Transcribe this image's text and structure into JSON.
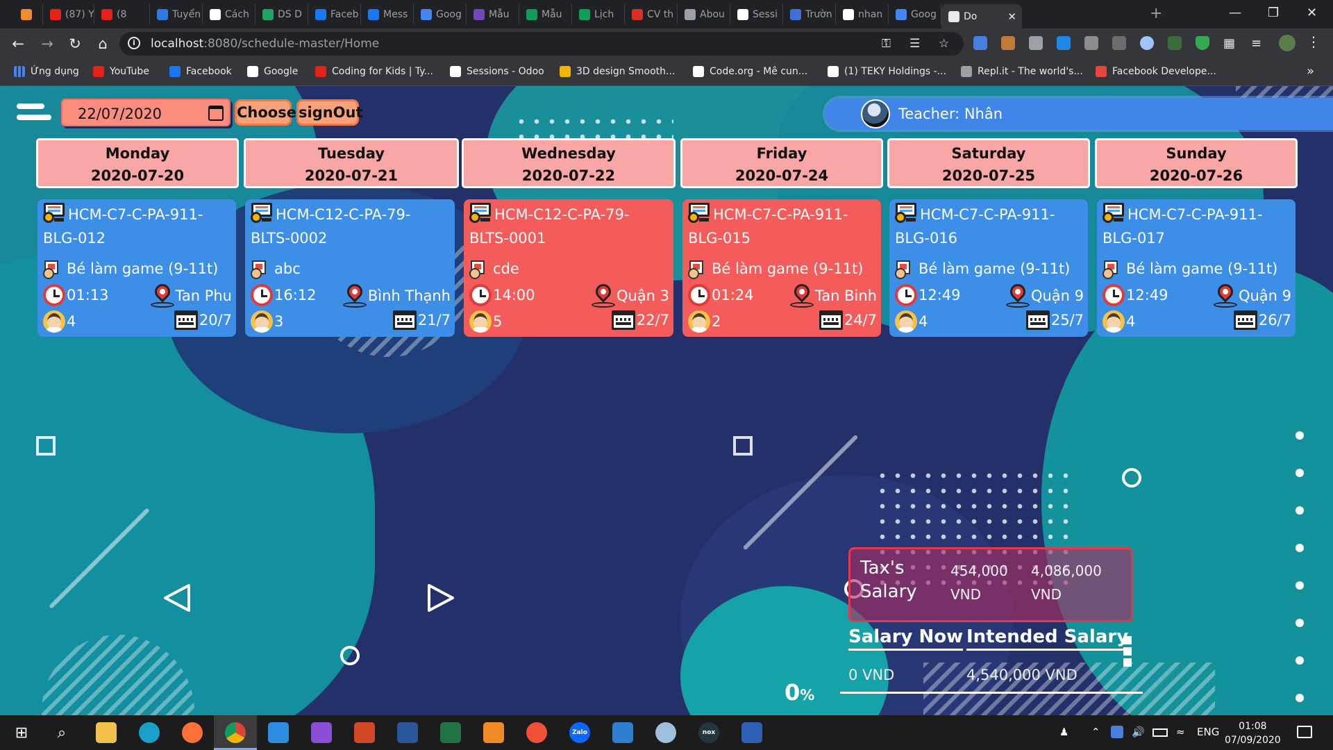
{
  "browser": {
    "tabs": [
      {
        "title": "",
        "color": "#f08c2a"
      },
      {
        "title": "(87) Y",
        "color": "#e62117"
      },
      {
        "title": "(8",
        "color": "#e62117"
      },
      {
        "title": "Tuyển",
        "color": "#2a7be4"
      },
      {
        "title": "Cách",
        "color": "#ffffff"
      },
      {
        "title": "DS D",
        "color": "#21a366"
      },
      {
        "title": "Faceb",
        "color": "#1877f2"
      },
      {
        "title": "Mess",
        "color": "#1877f2"
      },
      {
        "title": "Goog",
        "color": "#4285f4"
      },
      {
        "title": "Mẫu",
        "color": "#7248b9"
      },
      {
        "title": "Mẫu",
        "color": "#0f9d58"
      },
      {
        "title": "Lịch",
        "color": "#0f9d58"
      },
      {
        "title": "CV th",
        "color": "#d93025"
      },
      {
        "title": "Abou",
        "color": "#9aa0a6"
      },
      {
        "title": "Sessi",
        "color": "#ffffff"
      },
      {
        "title": "Trườn",
        "color": "#3f6fd8"
      },
      {
        "title": "nhan",
        "color": "#ffffff"
      },
      {
        "title": "Goog",
        "color": "#4285f4"
      },
      {
        "title": "Do",
        "color": "#e8eaed"
      }
    ],
    "close_tab": "✕",
    "new_tab": "+",
    "url_host": "localhost",
    "url_rest": ":8080/schedule-master/Home",
    "bookmarks": [
      {
        "label": "Ứng dụng",
        "color": "#4285f4"
      },
      {
        "label": "YouTube",
        "color": "#e62117"
      },
      {
        "label": "Facebook",
        "color": "#1877f2"
      },
      {
        "label": "Google",
        "color": "#ffffff"
      },
      {
        "label": "Coding for Kids | Ty...",
        "color": "#e62117"
      },
      {
        "label": "Sessions - Odoo",
        "color": "#ffffff"
      },
      {
        "label": "3D design Smooth...",
        "color": "#f5b400"
      },
      {
        "label": "Code.org - Mê cun...",
        "color": "#ffffff"
      },
      {
        "label": "(1) TEKY Holdings -...",
        "color": "#ffffff"
      },
      {
        "label": "Repl.it - The world's...",
        "color": "#9aa0a6"
      },
      {
        "label": "Facebook Develope...",
        "color": "#e8453c"
      }
    ],
    "more_bookmarks": "»"
  },
  "toolbar": {
    "date_value": "22/07/2020",
    "choose_label": "Choose",
    "signout_label": "signOut",
    "teacher_label": "Teacher: Nhân"
  },
  "days": [
    {
      "name": "Monday",
      "date": "2020-07-20"
    },
    {
      "name": "Tuesday",
      "date": "2020-07-21"
    },
    {
      "name": "Wednesday",
      "date": "2020-07-22"
    },
    {
      "name": "Friday",
      "date": "2020-07-24"
    },
    {
      "name": "Saturday",
      "date": "2020-07-25"
    },
    {
      "name": "Sunday",
      "date": "2020-07-26"
    }
  ],
  "classes": [
    {
      "code": "HCM-C7-C-PA-911-BLG-012",
      "course": "Bé làm game (9-11t)",
      "time": "01:13",
      "location": "Tan Phu",
      "students": "4",
      "date": "20/7",
      "status": "blue"
    },
    {
      "code": "HCM-C12-C-PA-79-BLTS-0002",
      "course": "abc",
      "time": "16:12",
      "location": "Bình Thạnh",
      "students": "3",
      "date": "21/7",
      "status": "blue"
    },
    {
      "code": "HCM-C12-C-PA-79-BLTS-0001",
      "course": "cde",
      "time": "14:00",
      "location": "Quận 3",
      "students": "5",
      "date": "22/7",
      "status": "red"
    },
    {
      "code": "HCM-C7-C-PA-911-BLG-015",
      "course": "Bé làm game (9-11t)",
      "time": "01:24",
      "location": "Tan Binh",
      "students": "2",
      "date": "24/7",
      "status": "red"
    },
    {
      "code": "HCM-C7-C-PA-911-BLG-016",
      "course": "Bé làm game (9-11t)",
      "time": "12:49",
      "location": "Quận 9",
      "students": "4",
      "date": "25/7",
      "status": "blue"
    },
    {
      "code": "HCM-C7-C-PA-911-BLG-017",
      "course": "Bé làm game (9-11t)",
      "time": "12:49",
      "location": "Quận 9",
      "students": "4",
      "date": "26/7",
      "status": "blue"
    }
  ],
  "salary": {
    "tax_label_1": "Tax's",
    "tax_label_2": "Salary",
    "tax_amount": "454,000",
    "salary_amount": "4,086,000",
    "currency": "VND",
    "salary_now_label": "Salary Now",
    "intended_label": "Intended Salary",
    "salary_now_value": "0 VND",
    "intended_value": "4,540,000 VND",
    "progress_value": "0",
    "progress_unit": "%"
  },
  "taskbar": {
    "lang": "ENG",
    "time": "01:08",
    "date": "07/09/2020",
    "apps": [
      "start",
      "search",
      "file-explorer",
      "edge-beta",
      "firefox",
      "chrome",
      "vscode",
      "visual-studio",
      "powerpoint",
      "word",
      "excel",
      "pdf",
      "swift",
      "zalo",
      "box",
      "paint",
      "nox",
      "powershell"
    ],
    "zalo_label": "Zalo",
    "nox_label": "nox"
  }
}
